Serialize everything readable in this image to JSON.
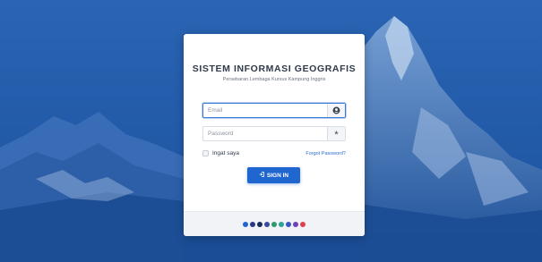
{
  "login": {
    "title": "SISTEM INFORMASI GEOGRAFIS",
    "subtitle": "Persebaran Lembaga Kursus Kampung Inggris",
    "email_placeholder": "Email",
    "email_value": "",
    "email_icon": "user-icon",
    "password_placeholder": "Password",
    "password_value": "",
    "password_icon": "asterisk-icon",
    "remember_label": "Ingat saya",
    "remember_checked": false,
    "forgot_label": "Forgot Password?",
    "signin_label": "SIGN IN",
    "signin_icon": "sign-in-icon"
  },
  "theme": {
    "accent": "#1f66d1",
    "link": "#2b6fd0",
    "background_tint": "#1d5aa8",
    "swatches": [
      "#1f66d1",
      "#2b3a86",
      "#162f5c",
      "#3a4a9e",
      "#2f9a6c",
      "#2ea29a",
      "#3b57c6",
      "#6a45b8",
      "#e0404e"
    ]
  }
}
